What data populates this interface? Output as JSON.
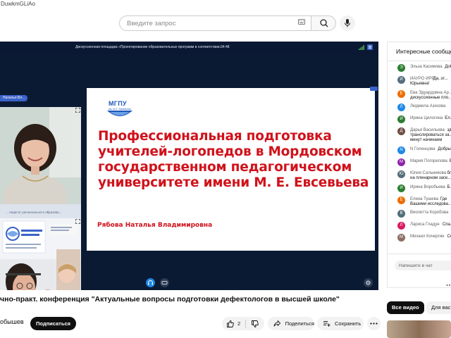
{
  "browser": {
    "url_fragment": "DuwkmGLiAo"
  },
  "search": {
    "placeholder": "Введите запрос"
  },
  "player": {
    "meeting_title": "Дискуссионная площадка «Проектирование образовательных программ в соответствии...",
    "meeting_time": "04:48",
    "participant_name_tag": "Наталья Вл...",
    "slide": {
      "logo_text": "МГПУ",
      "logo_sub": "им. М.Е. Евсевьева",
      "title_lines": [
        "Профессиональная подготовка",
        "учителей-логопедов в Мордовском",
        "государственном педагогическом",
        "университете имени М. Е. Евсевьева"
      ],
      "author": "Рябова Наталья Владимировна"
    }
  },
  "video": {
    "title": "чно-практ. конференция \"Актуальные вопросы подготовки дефектологов в высшей школе\"",
    "channel": "обышев",
    "subscribe_label": "Подписаться",
    "likes": "2",
    "share_label": "Поделиться",
    "save_label": "Сохранить"
  },
  "chat": {
    "header": "Интересные сообщения",
    "messages": [
      {
        "author": "Эльза Касимова",
        "text": "Доб...",
        "initial": "Э",
        "color": "#2e7d32"
      },
      {
        "author": "ИАУРО ИРР",
        "text": "Да, эт...",
        "text2": "Юрьевна!",
        "initial": "И",
        "color": "#546e7a"
      },
      {
        "author": "Ева Эдуардовна Ар...",
        "text": "дискуссионные пло...",
        "initial": "Е",
        "color": "#ef6c00"
      },
      {
        "author": "Людмила Азизова",
        "text": "",
        "initial": "Л",
        "color": "#1e88e5"
      },
      {
        "author": "Ирина Цилогина",
        "text": "Ел...",
        "initial": "И",
        "color": "#2e7d32"
      },
      {
        "author": "Дарья Васильева",
        "text": "здравствуйте! Дан...",
        "text2": "транслироваться за...",
        "text3": "минут начинаем",
        "initial": "Д",
        "color": "#6d4c41"
      },
      {
        "author": "N Голенцова",
        "text": "Добры...",
        "initial": "N",
        "color": "#1e88e5"
      },
      {
        "author": "Мария Погорелова",
        "text": "Владимировна!",
        "initial": "М",
        "color": "#8e24aa"
      },
      {
        "author": "Юлия Сальникова",
        "text": "благодарит за сооб...",
        "text2": "на пленарном засе...",
        "initial": "Ю",
        "color": "#546e7a"
      },
      {
        "author": "Ирина Воробьева",
        "text": "Б...",
        "initial": "И",
        "color": "#2e7d32"
      },
      {
        "author": "Елена Тушева",
        "text": "Где",
        "text2": "Вашими исследова...",
        "initial": "Е",
        "color": "#ef6c00"
      },
      {
        "author": "Виолетта Коробова",
        "text": "",
        "initial": "В",
        "color": "#546e7a"
      },
      {
        "author": "Лариса Гладун",
        "text": "Спа...",
        "initial": "Л",
        "color": "#d81b60"
      },
      {
        "author": "Михаил Кочергин",
        "text": "Се...",
        "initial": "М",
        "color": "#8d6e63"
      }
    ],
    "input_placeholder": "Напишите в чат"
  },
  "recommendations": {
    "chips": [
      "Все видео",
      "Для вас"
    ]
  },
  "colors": {
    "slide_title": "#d0121b",
    "brand_blue": "#1d58b8",
    "player_bg": "#0b1a33"
  }
}
